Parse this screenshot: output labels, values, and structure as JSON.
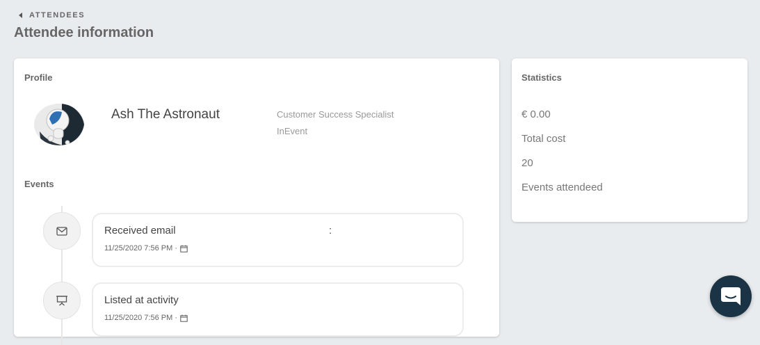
{
  "breadcrumb": {
    "label": "ATTENDEES"
  },
  "page": {
    "title": "Attendee information"
  },
  "profile": {
    "section_label": "Profile",
    "name": "Ash The Astronaut",
    "role": "Customer Success Specialist",
    "company": "InEvent"
  },
  "events": {
    "section_label": "Events",
    "items": [
      {
        "title": "Received email",
        "extra": ":",
        "datetime": "11/25/2020 7:56 PM ·",
        "icon": "envelope-icon"
      },
      {
        "title": "Listed at activity",
        "extra": "",
        "datetime": "11/25/2020 7:56 PM ·",
        "icon": "presentation-icon"
      }
    ]
  },
  "statistics": {
    "section_label": "Statistics",
    "total_cost_value": "€ 0.00",
    "total_cost_label": "Total cost",
    "events_attended_value": "20",
    "events_attended_label": "Events attendeed"
  },
  "colors": {
    "background": "#e9ecee",
    "chat_button": "#1b3445",
    "avatar_accent": "#2f6fb4"
  }
}
